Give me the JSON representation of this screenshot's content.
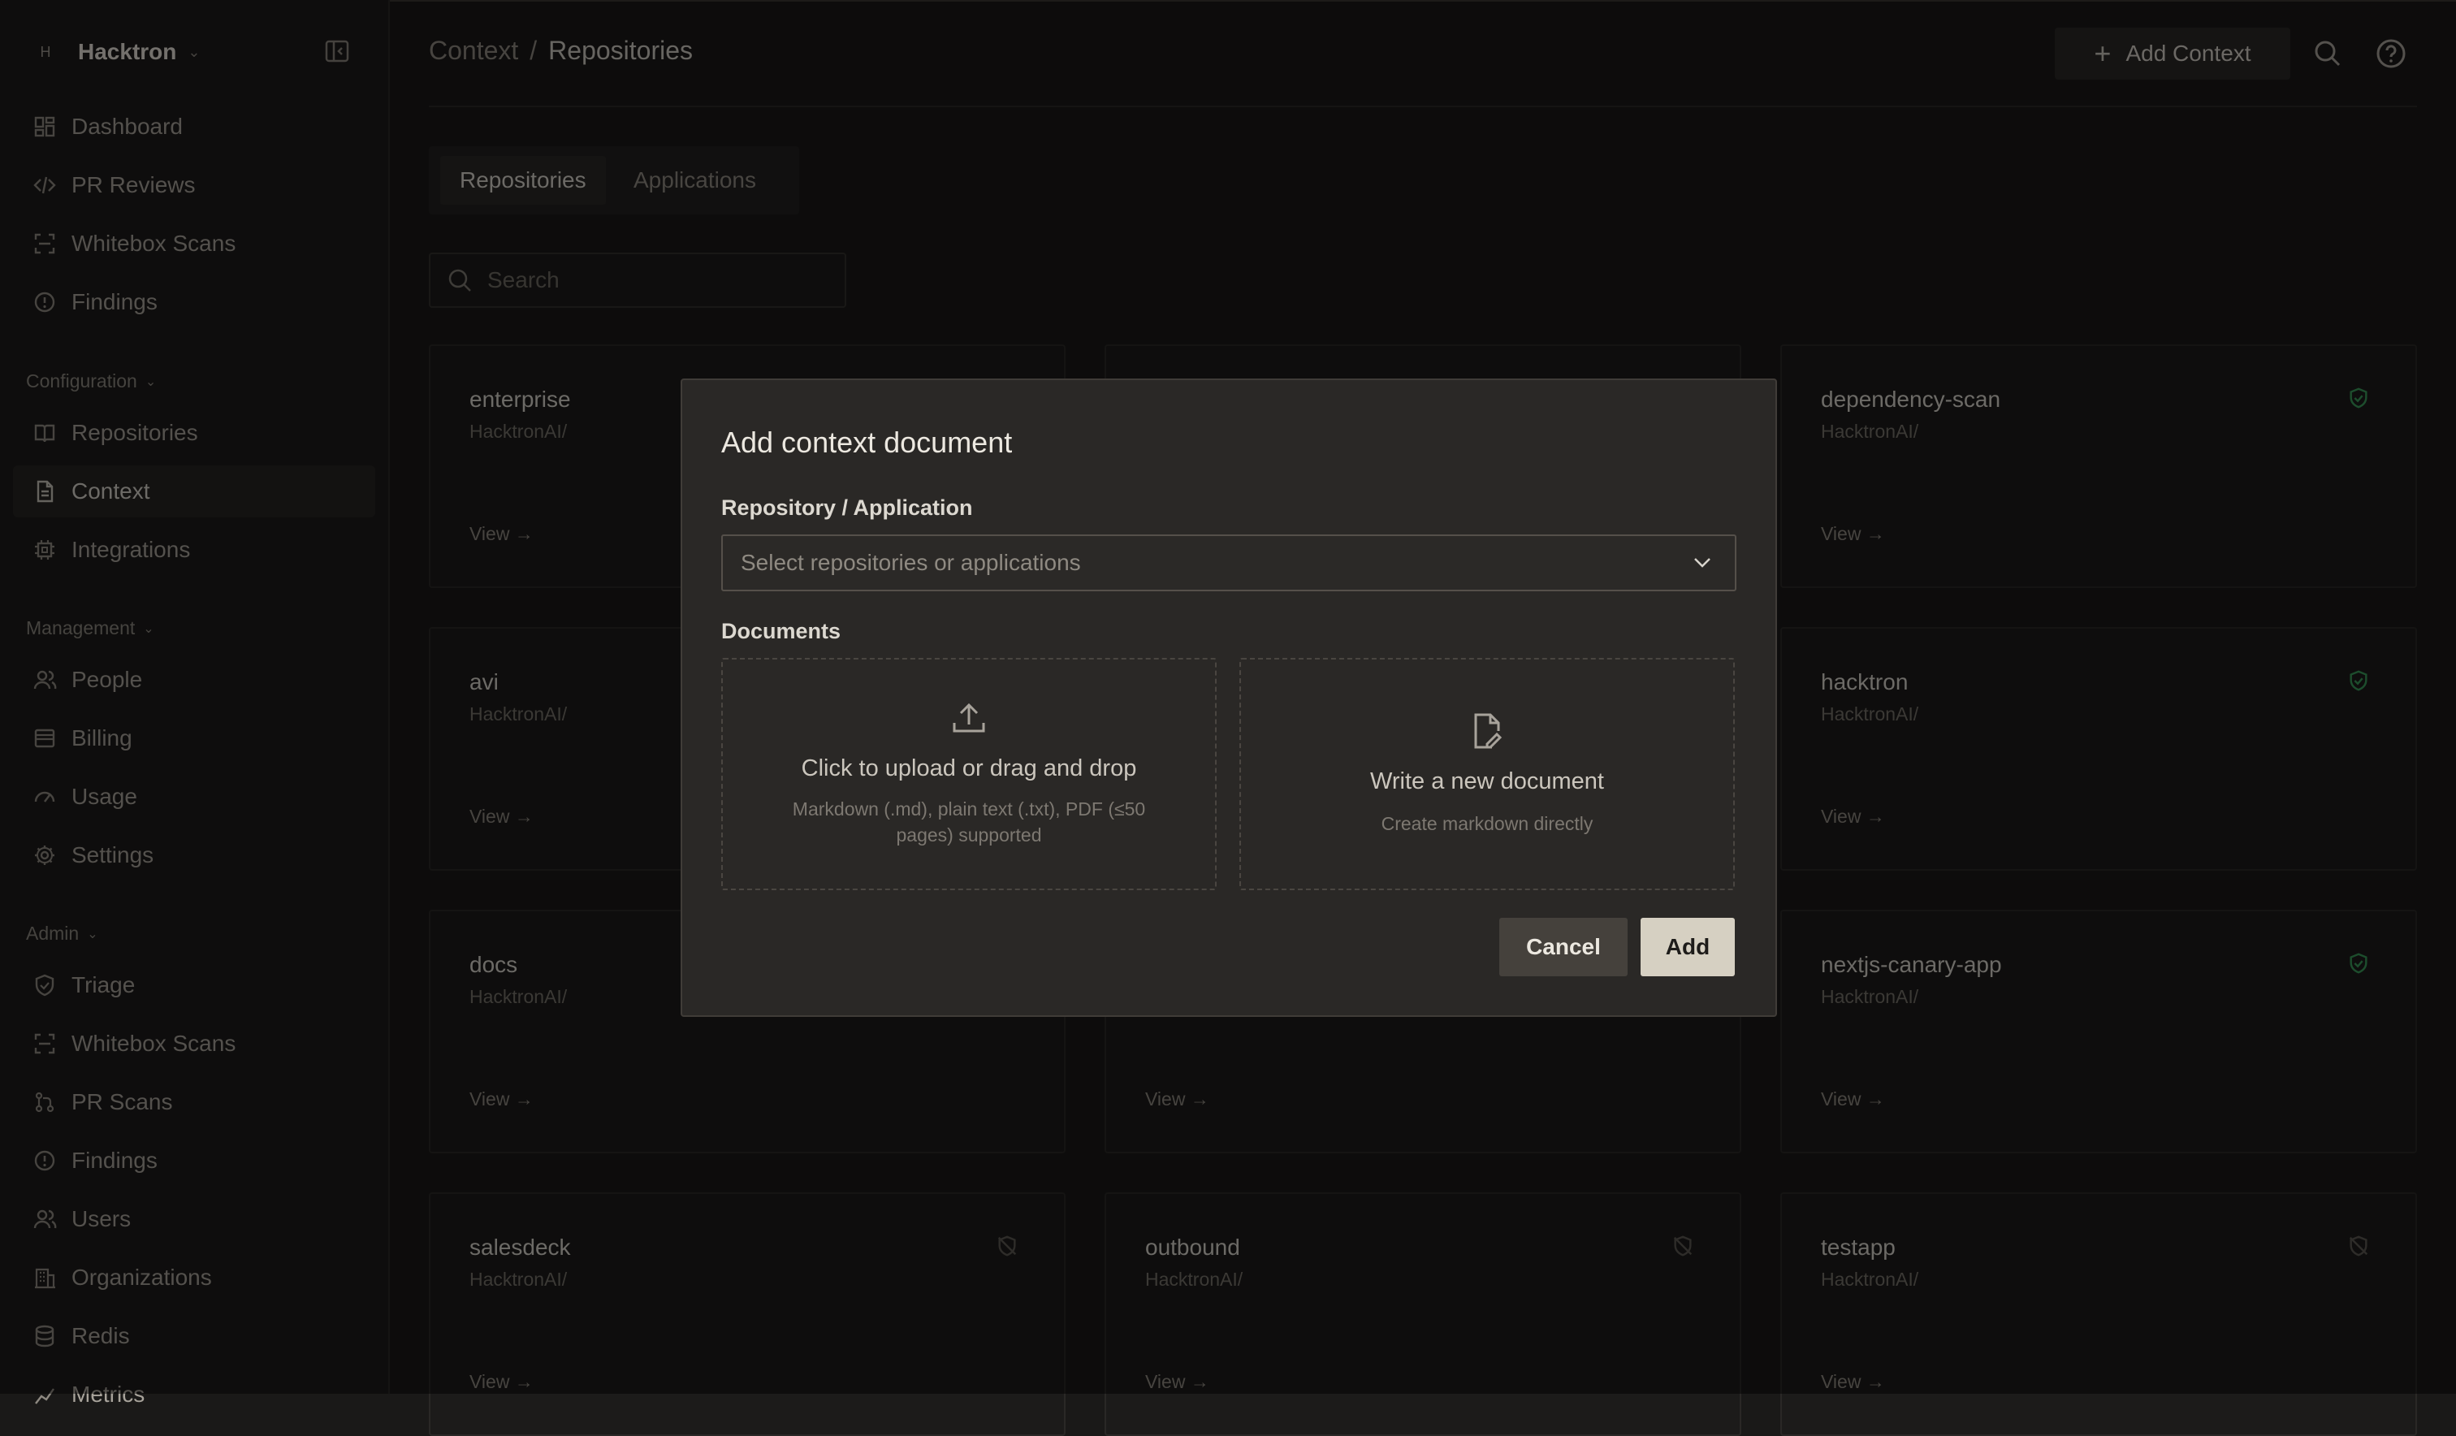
{
  "brand": {
    "logo_letter": "H",
    "name": "Hacktron"
  },
  "nav_main": [
    {
      "label": "Dashboard",
      "icon": "dashboard-icon"
    },
    {
      "label": "PR Reviews",
      "icon": "code-icon"
    },
    {
      "label": "Whitebox Scans",
      "icon": "scan-icon"
    },
    {
      "label": "Findings",
      "icon": "alert-icon"
    }
  ],
  "sections": {
    "configuration": "Configuration",
    "management": "Management",
    "admin": "Admin"
  },
  "nav_config": [
    {
      "label": "Repositories",
      "icon": "book-icon"
    },
    {
      "label": "Context",
      "icon": "document-icon",
      "active": true
    },
    {
      "label": "Integrations",
      "icon": "chip-icon"
    }
  ],
  "nav_management": [
    {
      "label": "People",
      "icon": "people-icon"
    },
    {
      "label": "Billing",
      "icon": "billing-icon"
    },
    {
      "label": "Usage",
      "icon": "gauge-icon"
    },
    {
      "label": "Settings",
      "icon": "gear-icon"
    }
  ],
  "nav_admin": [
    {
      "label": "Triage",
      "icon": "shield-icon"
    },
    {
      "label": "Whitebox Scans",
      "icon": "scan-icon"
    },
    {
      "label": "PR Scans",
      "icon": "branch-icon"
    },
    {
      "label": "Findings",
      "icon": "alert-icon"
    },
    {
      "label": "Users",
      "icon": "users-icon"
    },
    {
      "label": "Organizations",
      "icon": "building-icon"
    },
    {
      "label": "Redis",
      "icon": "database-icon"
    },
    {
      "label": "Metrics",
      "icon": "chart-icon"
    }
  ],
  "header": {
    "breadcrumb_parent": "Context",
    "breadcrumb_sep": "/",
    "breadcrumb_current": "Repositories",
    "add_context": "Add Context"
  },
  "tabs": {
    "repositories": "Repositories",
    "applications": "Applications"
  },
  "search": {
    "placeholder": "Search"
  },
  "cards": [
    {
      "title": "enterprise",
      "owner": "HacktronAI/",
      "view": "View →",
      "status": "none"
    },
    {
      "title": "",
      "owner": "",
      "view": "",
      "status": "none"
    },
    {
      "title": "dependency-scan",
      "owner": "HacktronAI/",
      "view": "View →",
      "status": "protected"
    },
    {
      "title": "avi",
      "owner": "HacktronAI/",
      "view": "View →",
      "status": "none"
    },
    {
      "title": "",
      "owner": "",
      "view": "",
      "status": "none"
    },
    {
      "title": "hacktron",
      "owner": "HacktronAI/",
      "view": "View →",
      "status": "protected"
    },
    {
      "title": "docs",
      "owner": "HacktronAI/",
      "view": "View →",
      "status": "none"
    },
    {
      "title": "",
      "owner": "",
      "view": "View →",
      "status": "none"
    },
    {
      "title": "nextjs-canary-app",
      "owner": "HacktronAI/",
      "view": "View →",
      "status": "protected"
    },
    {
      "title": "salesdeck",
      "owner": "HacktronAI/",
      "view": "View →",
      "status": "unprotected"
    },
    {
      "title": "outbound",
      "owner": "HacktronAI/",
      "view": "View →",
      "status": "unprotected"
    },
    {
      "title": "testapp",
      "owner": "HacktronAI/",
      "view": "View →",
      "status": "unprotected"
    }
  ],
  "modal": {
    "title": "Add context document",
    "repo_label": "Repository / Application",
    "select_placeholder": "Select repositories or applications",
    "documents_label": "Documents",
    "upload_title": "Click to upload or drag and drop",
    "upload_sub": "Markdown (.md), plain text (.txt), PDF (≤50 pages) supported",
    "write_title": "Write a new document",
    "write_sub": "Create markdown directly",
    "cancel": "Cancel",
    "add": "Add"
  },
  "colors": {
    "accent_green": "#3a9a5b",
    "background": "#1a1918",
    "modal_bg": "#2a2826",
    "primary_button": "#d6d0c2"
  }
}
